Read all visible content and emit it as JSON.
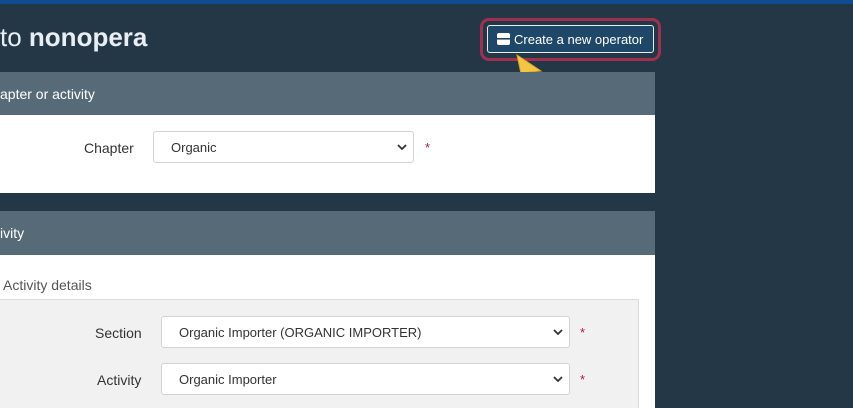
{
  "header": {
    "title_prefix": "to",
    "title_name": "nonopera",
    "create_button_label": "Create a new operator"
  },
  "chapter_panel": {
    "heading": "apter or activity",
    "chapter_label": "Chapter",
    "chapter_value": "Organic"
  },
  "activity_panel": {
    "heading": "ivity",
    "subsection_title": "Activity details",
    "section_label": "Section",
    "section_value": "Organic Importer (ORGANIC IMPORTER)",
    "activity_label": "Activity",
    "activity_value": "Organic Importer"
  },
  "required_marker": "*",
  "colors": {
    "background": "#233746",
    "panel_header": "#566a77",
    "button": "#1f4768",
    "highlight": "#a0304f",
    "required": "#b0183d",
    "cursor": "#f4c542"
  },
  "icons": {
    "button_icon": "address-card-icon",
    "select_icon": "chevron-down-icon",
    "pointer": "cursor-arrow-icon"
  }
}
